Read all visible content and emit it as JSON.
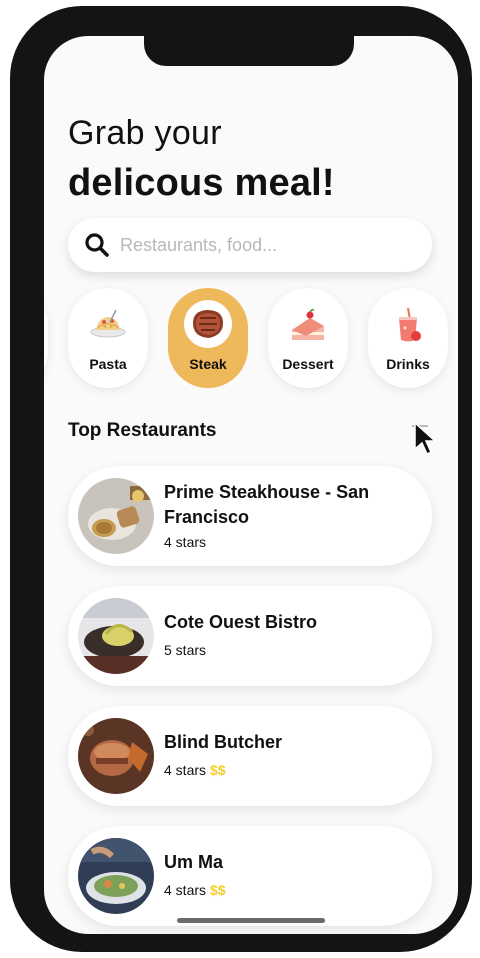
{
  "greeting": {
    "line1": "Grab your",
    "line2": "delicous meal!"
  },
  "search": {
    "placeholder": "Restaurants, food..."
  },
  "categories": [
    {
      "label": "Pasta",
      "icon": "pasta-icon",
      "active": false
    },
    {
      "label": "Steak",
      "icon": "steak-icon",
      "active": true
    },
    {
      "label": "Dessert",
      "icon": "cake-icon",
      "active": false
    },
    {
      "label": "Drinks",
      "icon": "drink-icon",
      "active": false
    }
  ],
  "section": {
    "title": "Top Restaurants"
  },
  "restaurants": [
    {
      "name": "Prime  Steakhouse - San Francisco",
      "rating": "4 stars",
      "price": ""
    },
    {
      "name": "Cote Ouest Bistro",
      "rating": "5 stars",
      "price": ""
    },
    {
      "name": "Blind Butcher",
      "rating": "4 stars",
      "price": "$$"
    },
    {
      "name": "Um Ma",
      "rating": "4 stars",
      "price": "$$"
    }
  ],
  "colors": {
    "accent": "#edb95a",
    "price": "#f2cc2a",
    "frame": "#141414"
  }
}
